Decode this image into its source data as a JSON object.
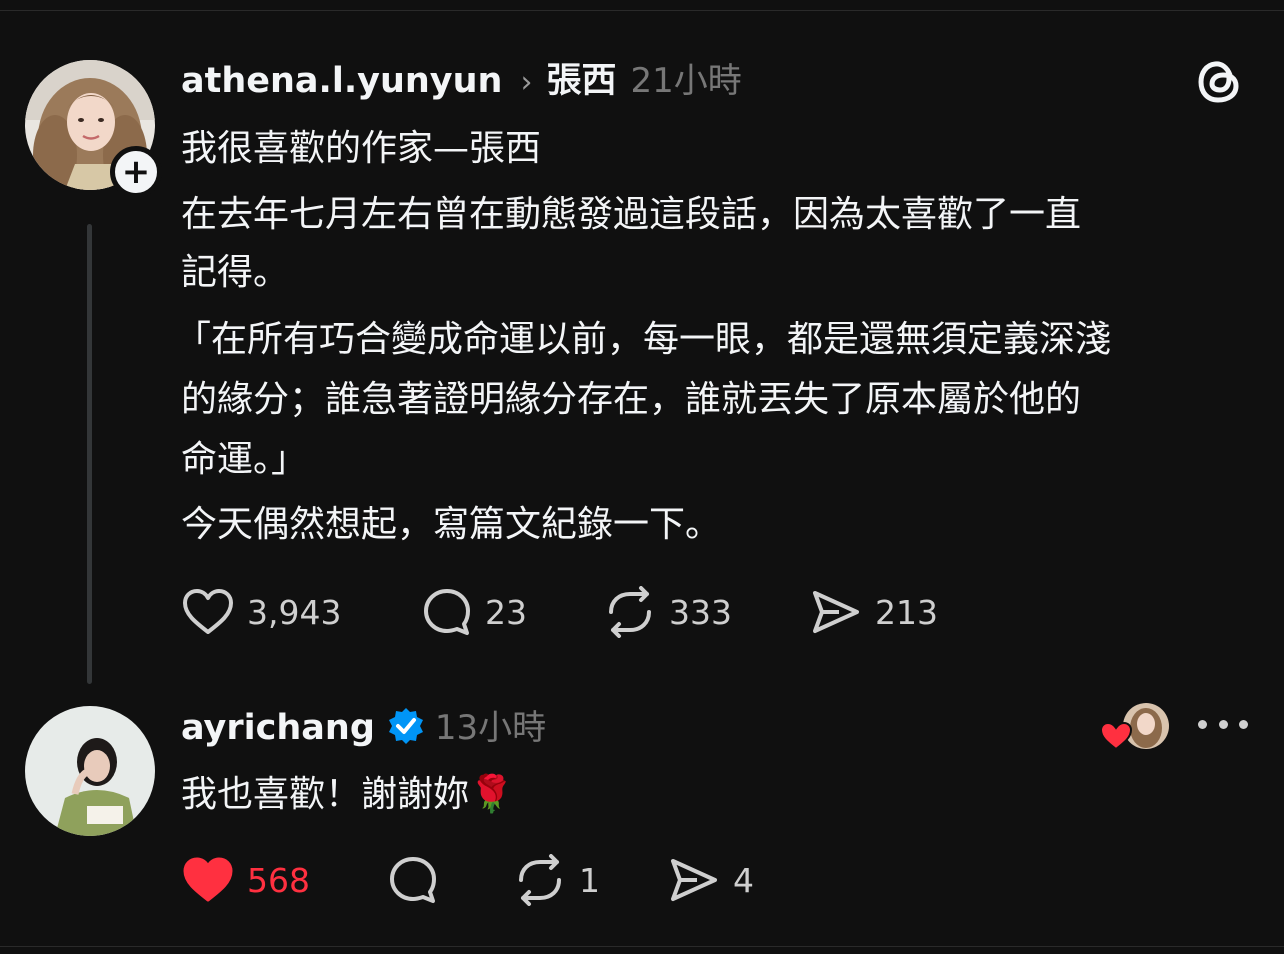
{
  "post": {
    "username": "athena.l.yunyun",
    "topic": "張西",
    "time": "21小時",
    "lines": [
      "我很喜歡的作家—張西",
      "在去年七月左右曾在動態發過這段話，因為太喜歡了一直",
      "記得。",
      "「在所有巧合變成命運以前，每一眼，都是還無須定義深淺",
      "的緣分；誰急著證明緣分存在，誰就丟失了原本屬於他的",
      "命運。」",
      "今天偶然想起，寫篇文紀錄一下。"
    ],
    "likes": "3,943",
    "replies": "23",
    "reposts": "333",
    "shares": "213"
  },
  "reply": {
    "username": "ayrichang",
    "time": "13小時",
    "text": "我也喜歡！謝謝妳🌹",
    "likes": "568",
    "reposts": "1",
    "shares": "4"
  },
  "icons": {
    "brand": "threads-logo",
    "heart": "heart-icon",
    "comment": "comment-icon",
    "repost": "repost-icon",
    "share": "share-icon",
    "more": "more-icon",
    "verified": "verified-badge-icon"
  },
  "colors": {
    "background": "#101010",
    "liked": "#ff3040",
    "verified": "#0095f6",
    "muted": "#777777"
  }
}
